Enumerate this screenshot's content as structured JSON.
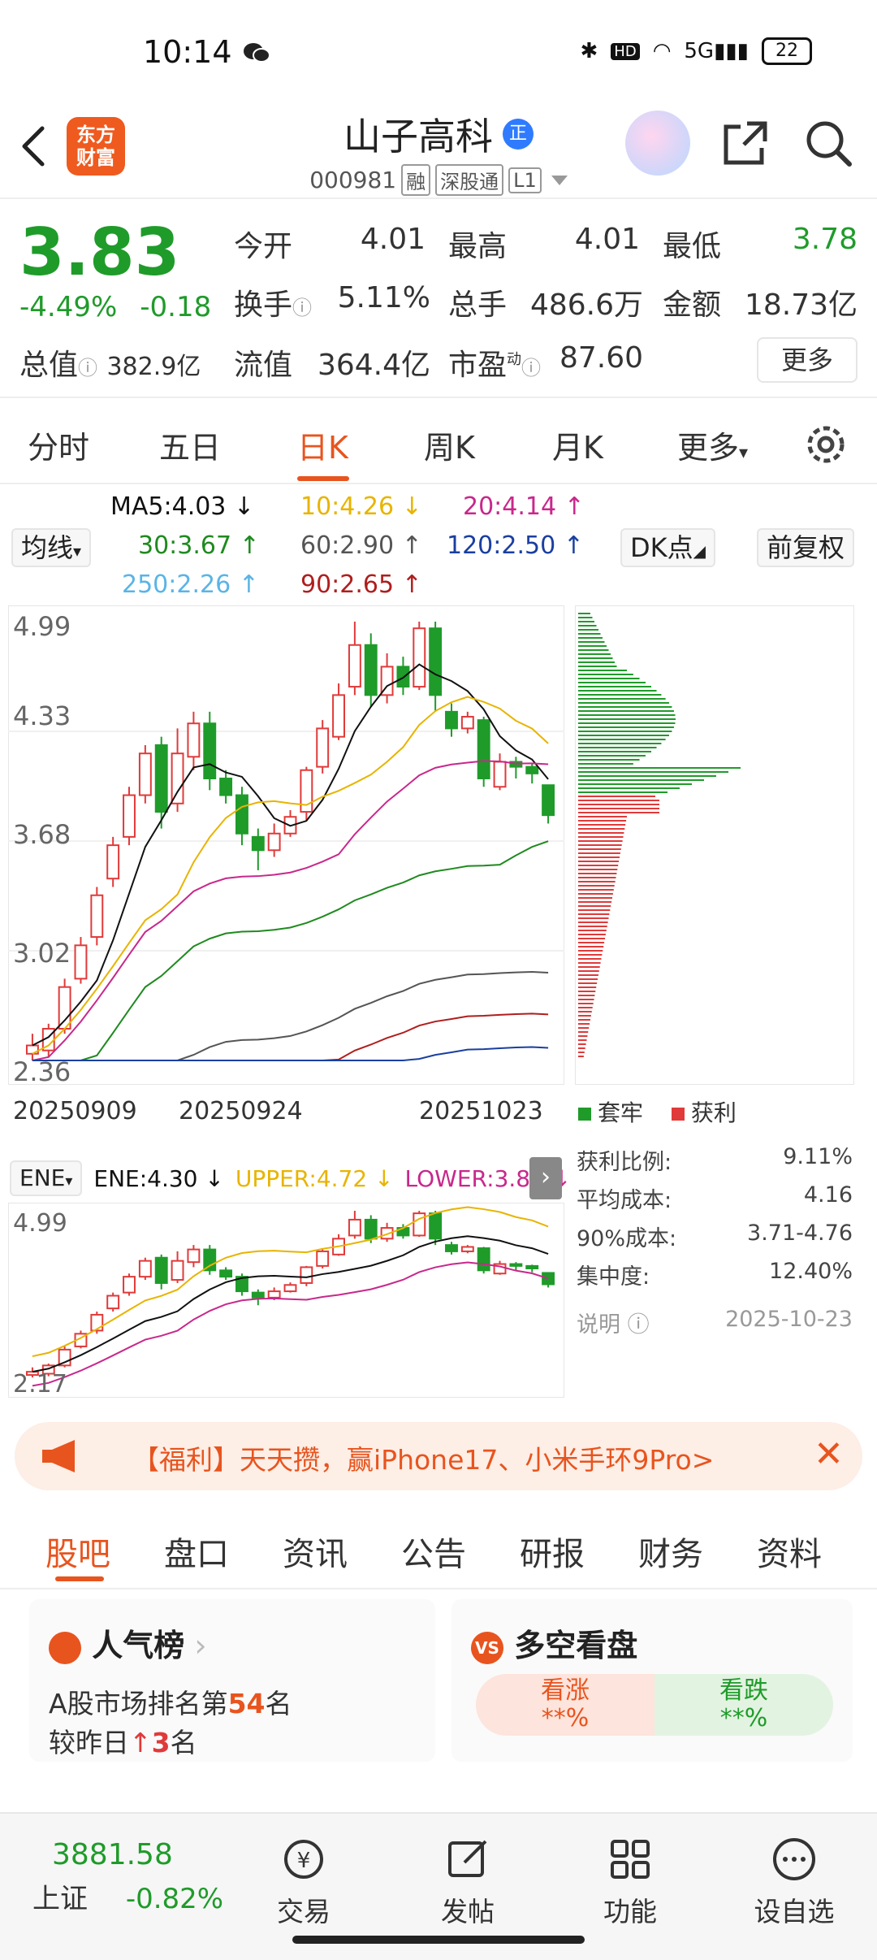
{
  "status": {
    "time": "10:14",
    "battery": "22"
  },
  "header": {
    "logo": "东方\n财富",
    "stock_name": "山子高科",
    "verified": "正",
    "code": "000981",
    "tags": [
      "融",
      "深股通",
      "L1"
    ]
  },
  "quote": {
    "price": "3.83",
    "change_pct": "-4.49%",
    "change": "-0.18",
    "total_cap_label": "总值",
    "total_cap": "382.9亿",
    "open_label": "今开",
    "open": "4.01",
    "high_label": "最高",
    "high": "4.01",
    "low_label": "最低",
    "low": "3.78",
    "turnover_label": "换手",
    "turnover": "5.11%",
    "volume_label": "总手",
    "volume": "486.6万",
    "amount_label": "金额",
    "amount": "18.73亿",
    "float_cap_label": "流值",
    "float_cap": "364.4亿",
    "pe_label": "市盈",
    "pe_sup": "动",
    "pe": "87.60",
    "more": "更多"
  },
  "tabs": [
    "分时",
    "五日",
    "日K",
    "周K",
    "月K",
    "更多"
  ],
  "active_tab": "日K",
  "ma": {
    "selector": "均线",
    "ma5": "MA5:4.03 ↓",
    "ma10": "10:4.26 ↓",
    "ma20": "20:4.14 ↑",
    "ma30": "30:3.67 ↑",
    "ma60": "60:2.90 ↑",
    "ma120": "120:2.50 ↑",
    "ma250": "250:2.26 ↑",
    "ma90": "90:2.65 ↑",
    "dk": "DK点",
    "adjust": "前复权"
  },
  "colors": {
    "up": "#e03a3a",
    "down": "#1f9b2a",
    "accent": "#e8541e",
    "ma5": "#111111",
    "ma10": "#e8b400",
    "ma20": "#c8288c",
    "ma30": "#1f8a1f",
    "ma60": "#555555",
    "ma120": "#1a3fa0",
    "ma250": "#5ab4e6",
    "ma90": "#b01e1e"
  },
  "chart_data": {
    "type": "candlestick",
    "y_ticks": [
      "4.99",
      "4.33",
      "3.68",
      "3.02",
      "2.36"
    ],
    "x_ticks": [
      "20250909",
      "20250924",
      "20251023"
    ],
    "candles": [
      {
        "o": 2.4,
        "c": 2.45,
        "h": 2.52,
        "l": 2.36
      },
      {
        "o": 2.42,
        "c": 2.55,
        "h": 2.58,
        "l": 2.38
      },
      {
        "o": 2.55,
        "c": 2.8,
        "h": 2.85,
        "l": 2.52
      },
      {
        "o": 2.85,
        "c": 3.05,
        "h": 3.1,
        "l": 2.82
      },
      {
        "o": 3.1,
        "c": 3.35,
        "h": 3.4,
        "l": 3.05
      },
      {
        "o": 3.45,
        "c": 3.65,
        "h": 3.7,
        "l": 3.4
      },
      {
        "o": 3.7,
        "c": 3.95,
        "h": 4.0,
        "l": 3.65
      },
      {
        "o": 3.95,
        "c": 4.2,
        "h": 4.25,
        "l": 3.9
      },
      {
        "o": 4.25,
        "c": 3.85,
        "h": 4.3,
        "l": 3.75
      },
      {
        "o": 3.9,
        "c": 4.2,
        "h": 4.35,
        "l": 3.85
      },
      {
        "o": 4.18,
        "c": 4.38,
        "h": 4.45,
        "l": 4.1
      },
      {
        "o": 4.38,
        "c": 4.05,
        "h": 4.45,
        "l": 3.98
      },
      {
        "o": 4.05,
        "c": 3.95,
        "h": 4.1,
        "l": 3.9
      },
      {
        "o": 3.95,
        "c": 3.72,
        "h": 4.0,
        "l": 3.65
      },
      {
        "o": 3.7,
        "c": 3.62,
        "h": 3.75,
        "l": 3.5
      },
      {
        "o": 3.62,
        "c": 3.72,
        "h": 3.78,
        "l": 3.58
      },
      {
        "o": 3.72,
        "c": 3.82,
        "h": 3.86,
        "l": 3.7
      },
      {
        "o": 3.85,
        "c": 4.1,
        "h": 4.12,
        "l": 3.8
      },
      {
        "o": 4.12,
        "c": 4.35,
        "h": 4.4,
        "l": 4.08
      },
      {
        "o": 4.3,
        "c": 4.55,
        "h": 4.62,
        "l": 4.28
      },
      {
        "o": 4.6,
        "c": 4.85,
        "h": 4.99,
        "l": 4.55
      },
      {
        "o": 4.85,
        "c": 4.55,
        "h": 4.92,
        "l": 4.48
      },
      {
        "o": 4.55,
        "c": 4.72,
        "h": 4.8,
        "l": 4.5
      },
      {
        "o": 4.72,
        "c": 4.6,
        "h": 4.78,
        "l": 4.55
      },
      {
        "o": 4.6,
        "c": 4.95,
        "h": 4.99,
        "l": 4.58
      },
      {
        "o": 4.95,
        "c": 4.55,
        "h": 4.99,
        "l": 4.45
      },
      {
        "o": 4.45,
        "c": 4.35,
        "h": 4.5,
        "l": 4.3
      },
      {
        "o": 4.35,
        "c": 4.42,
        "h": 4.45,
        "l": 4.32
      },
      {
        "o": 4.4,
        "c": 4.05,
        "h": 4.42,
        "l": 4.0
      },
      {
        "o": 4.0,
        "c": 4.15,
        "h": 4.2,
        "l": 3.98
      },
      {
        "o": 4.15,
        "c": 4.12,
        "h": 4.18,
        "l": 4.05
      },
      {
        "o": 4.12,
        "c": 4.08,
        "h": 4.14,
        "l": 4.02
      },
      {
        "o": 4.01,
        "c": 3.83,
        "h": 4.01,
        "l": 3.78
      }
    ],
    "ylim": [
      2.36,
      4.99
    ]
  },
  "chips": {
    "legend_trap": "套牢",
    "legend_profit": "获利",
    "stats": [
      {
        "label": "获利比例:",
        "value": "9.11%"
      },
      {
        "label": "平均成本:",
        "value": "4.16"
      },
      {
        "label": "90%成本:",
        "value": "3.71-4.76"
      },
      {
        "label": "集中度:",
        "value": "12.40%"
      }
    ],
    "note_label": "说明",
    "date": "2025-10-23"
  },
  "ene": {
    "selector": "ENE",
    "ene": "ENE:4.30 ↓",
    "upper": "UPPER:4.72 ↓",
    "lower": "LOWER:3.87 ↓",
    "y_top": "4.99",
    "y_bottom": "2.17"
  },
  "banner": {
    "text": "【福利】天天攒，赢iPhone17、小米手环9Pro>"
  },
  "bottom_tabs": [
    "股吧",
    "盘口",
    "资讯",
    "公告",
    "研报",
    "财务",
    "资料"
  ],
  "cards": {
    "popular_title": "人气榜",
    "rank_prefix": "A股市场排名第",
    "rank": "54",
    "rank_suffix": "名",
    "change_prefix": "较昨日",
    "change_value": "3",
    "change_suffix": "名",
    "longshort_title": "多空看盘",
    "bull_label": "看涨",
    "bull_value": "**%",
    "bear_label": "看跌",
    "bear_value": "**%"
  },
  "dock": {
    "index_value": "3881.58",
    "index_name": "上证",
    "index_change": "-0.82%",
    "items": [
      "交易",
      "发帖",
      "功能",
      "设自选"
    ]
  }
}
